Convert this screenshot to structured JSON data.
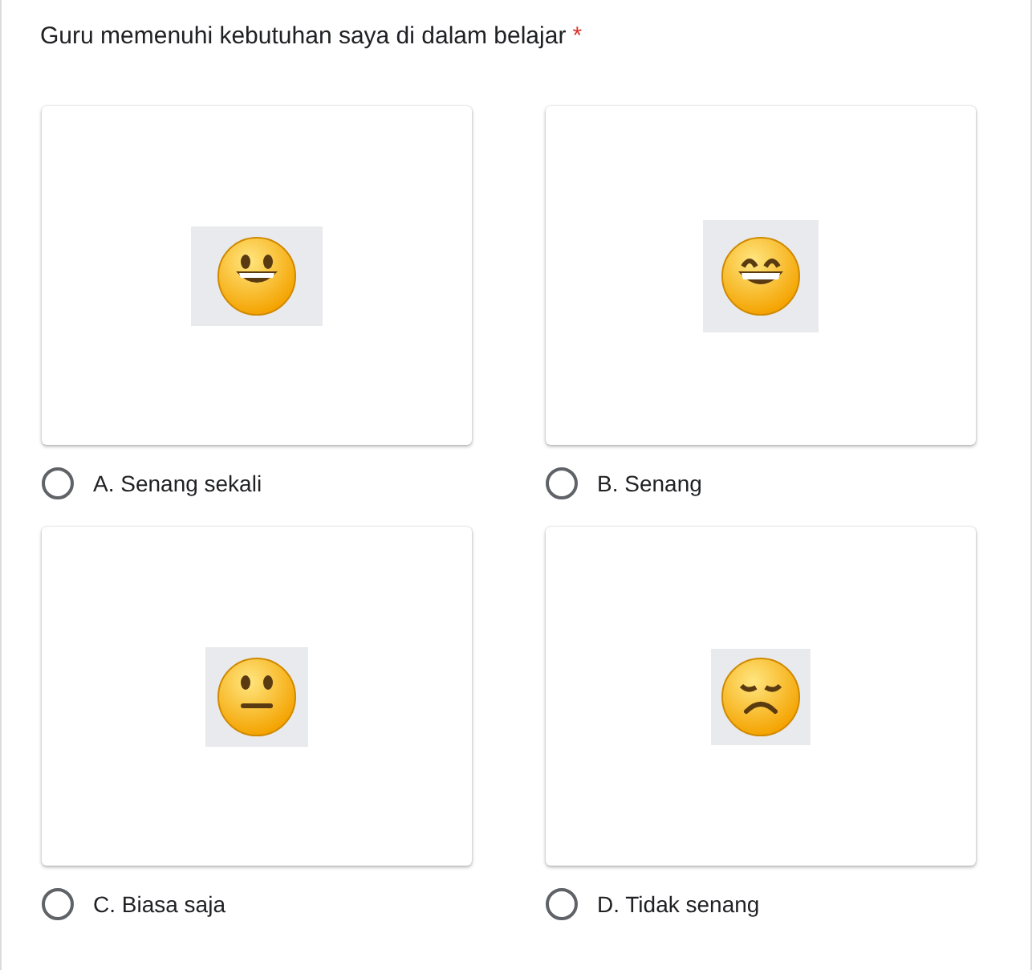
{
  "question": {
    "title": "Guru memenuhi kebutuhan saya di dalam belajar",
    "required_mark": "*"
  },
  "options": [
    {
      "label": "A. Senang sekali",
      "selected": false
    },
    {
      "label": "B. Senang",
      "selected": false
    },
    {
      "label": "C. Biasa saja",
      "selected": false
    },
    {
      "label": "D. Tidak senang",
      "selected": false
    }
  ]
}
